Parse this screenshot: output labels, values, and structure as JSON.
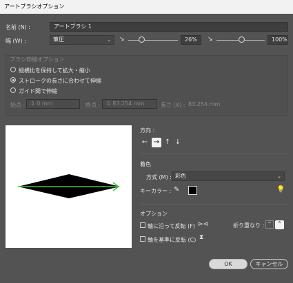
{
  "window": {
    "title": "アートブラシオプション"
  },
  "name": {
    "label": "名前 (N) :",
    "value": "アートブラシ 1"
  },
  "width": {
    "label": "幅 (W) :",
    "mode": "筆圧",
    "min_percent": "26%",
    "max_percent": "100%",
    "min_level": 0.26,
    "max_level": 1.0
  },
  "scale_options": {
    "title": "ブラシ伸縮オプション",
    "options": [
      {
        "label": "縦横比を保持して拡大・縮小",
        "selected": false
      },
      {
        "label": "ストロークの長さに合わせて伸縮",
        "selected": true
      },
      {
        "label": "ガイド間で伸縮",
        "selected": false
      }
    ],
    "start": {
      "label": "始点 :",
      "value": "0 mm"
    },
    "end": {
      "label": "終点 :",
      "value": "83.254 mm"
    },
    "length": {
      "label": "長さ [X] :",
      "value": "83.254 mm"
    }
  },
  "direction": {
    "title": "方向 :",
    "arrows": [
      "←",
      "→",
      "↑",
      "↓"
    ],
    "selected_index": 1
  },
  "colorization": {
    "title": "着色",
    "method_label": "方式 (M) :",
    "method_value": "彩色",
    "key_color_label": "キーカラー :",
    "key_color": "#000000"
  },
  "options": {
    "title": "オプション",
    "flip_along": {
      "label": "軸に沿って反転 (F)",
      "checked": false
    },
    "flip_across": {
      "label": "軸を基準に反転 (C)",
      "checked": false
    },
    "overlap_label": "折り重なり :"
  },
  "buttons": {
    "ok": "OK",
    "cancel": "キャンセル"
  },
  "colors": {
    "background": "#535353",
    "arrow": "#3cc43c",
    "shape": "#000000",
    "preview_bg": "#ffffff"
  }
}
